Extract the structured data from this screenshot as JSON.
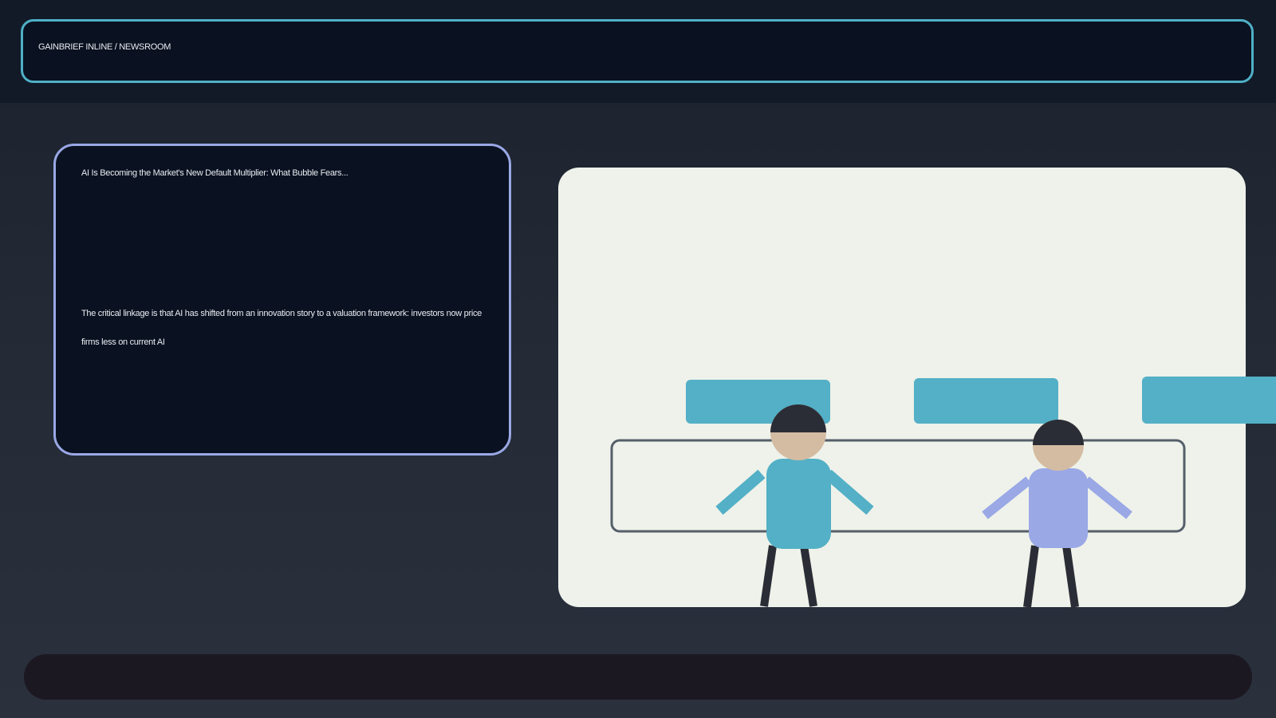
{
  "header": {
    "label": "GAINBRIEF INLINE / NEWSROOM"
  },
  "story_card": {
    "title": "AI Is Becoming the Market's New Default Multiplier: What Bubble Fears...",
    "body": "The critical linkage is that AI has shifted from an innovation story to a valuation framework: investors now price firms less on current AI"
  },
  "illustration": {
    "background_color": "#eef2ea",
    "accent_color": "#53b0c6",
    "secondary_color": "#9aa8e6",
    "figures": [
      "person-teal-shirt",
      "person-lavender-shirt"
    ]
  },
  "colors": {
    "header_border": "#4fb0c6",
    "card_border": "#9aa8e6",
    "panel_bg": "#0a1120",
    "footer_bg": "#1c1822"
  }
}
